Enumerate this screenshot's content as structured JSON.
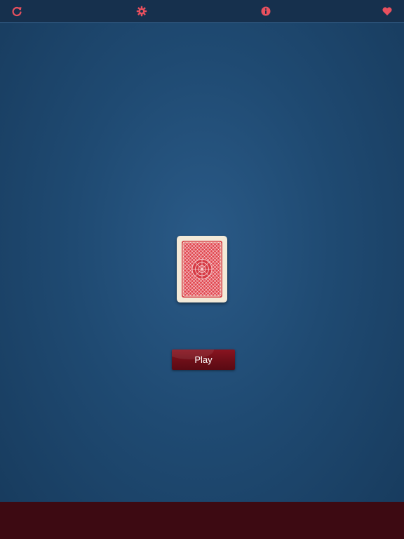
{
  "toolbar": {
    "icons": [
      "refresh-icon",
      "gear-icon",
      "info-icon",
      "heart-icon"
    ],
    "icon_color": "#e8505e",
    "background": "#16304d"
  },
  "deck": {
    "card_back_color": "#d63a44",
    "card_face_color": "#f3ead8"
  },
  "play_button": {
    "label": "Play",
    "color": "#6d0e18"
  },
  "bottom_bar": {
    "color": "#3d0a12"
  }
}
